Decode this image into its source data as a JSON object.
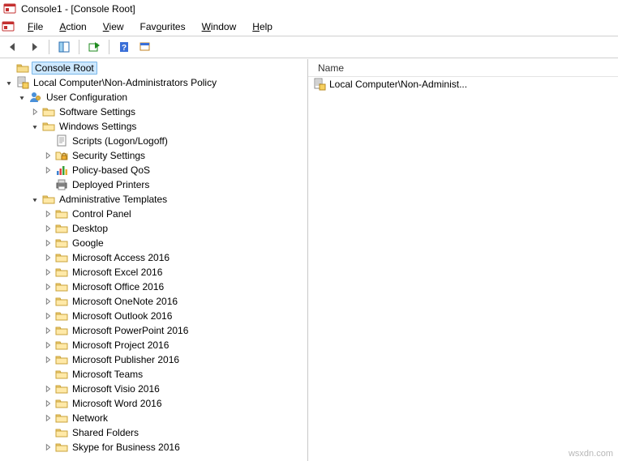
{
  "window": {
    "title": "Console1 - [Console Root]"
  },
  "menu": {
    "file": "File",
    "action": "Action",
    "view": "View",
    "favourites": "Favourites",
    "window": "Window",
    "help": "Help"
  },
  "list": {
    "header_name": "Name",
    "items": [
      {
        "label": "Local Computer\\Non-Administ..."
      }
    ]
  },
  "tree": {
    "root": "Console Root",
    "policy": "Local Computer\\Non-Administrators Policy",
    "user_config": "User Configuration",
    "software_settings": "Software Settings",
    "windows_settings": "Windows Settings",
    "scripts": "Scripts (Logon/Logoff)",
    "security": "Security Settings",
    "qos": "Policy-based QoS",
    "printers": "Deployed Printers",
    "admin_templates": "Administrative Templates",
    "at": {
      "control_panel": "Control Panel",
      "desktop": "Desktop",
      "google": "Google",
      "access": "Microsoft Access 2016",
      "excel": "Microsoft Excel 2016",
      "office": "Microsoft Office 2016",
      "onenote": "Microsoft OneNote 2016",
      "outlook": "Microsoft Outlook 2016",
      "powerpoint": "Microsoft PowerPoint 2016",
      "project": "Microsoft Project 2016",
      "publisher": "Microsoft Publisher 2016",
      "teams": "Microsoft Teams",
      "visio": "Microsoft Visio 2016",
      "word": "Microsoft Word 2016",
      "network": "Network",
      "shared_folders": "Shared Folders",
      "skype": "Skype for Business 2016"
    }
  },
  "watermark": "wsxdn.com"
}
